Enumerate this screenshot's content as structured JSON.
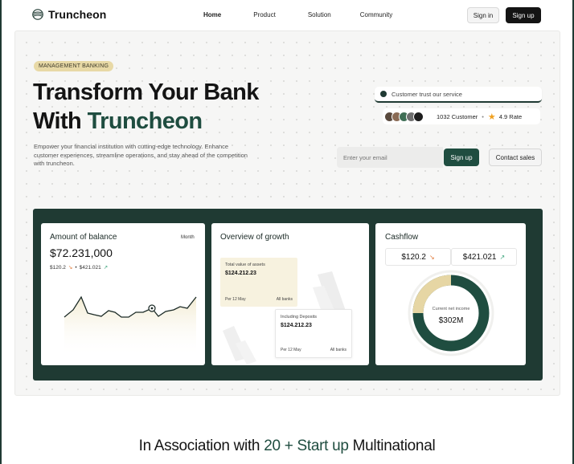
{
  "brand": {
    "name": "Truncheon"
  },
  "nav": {
    "links": [
      "Home",
      "Product",
      "Solution",
      "Community"
    ],
    "sign_in": "Sign in",
    "sign_up": "Sign up"
  },
  "hero": {
    "badge": "MANAGEMENT BANKING",
    "headline_line1": "Transform Your Bank",
    "headline_line2_prefix": "With",
    "headline_line2_accent": "Truncheon",
    "description": "Empower your financial institution with cutting-edge technology. Enhance customer experiences, streamline operations, and stay ahead of the competition with truncheon.",
    "trust_label": "Customer trust our service",
    "customer_count": "1032 Customer",
    "rating": "4.9 Rate",
    "email_placeholder": "Enter your email",
    "signup_button": "Sign up",
    "contact_button": "Contact sales"
  },
  "cards": {
    "balance": {
      "title": "Amount of balance",
      "period": "Month",
      "value": "$72.231,000",
      "sub_down": "$120.2",
      "sub_up": "$421.021"
    },
    "growth": {
      "title": "Overview of growth",
      "card1_label": "Total value of assets",
      "card1_value": "$124.212.23",
      "card1_date": "Per 12 May",
      "card1_scope": "All banks",
      "card2_label": "Including Deposits",
      "card2_value": "$124.212.23",
      "card2_date": "Per 12 May",
      "card2_scope": "All banks"
    },
    "cashflow": {
      "title": "Cashflow",
      "left_value": "$120.2",
      "right_value": "$421.021",
      "donut_label": "Current net income",
      "donut_value": "$302M",
      "donut_share": 0.25
    }
  },
  "association": {
    "prefix": "In Association with",
    "accent": "20 + Start up",
    "suffix": "Multinational"
  },
  "colors": {
    "brand_green": "#1f4d40",
    "panel_green": "#1f3a33",
    "badge_gold": "#e8d9a6",
    "accent_gold": "#e6d6a4"
  }
}
